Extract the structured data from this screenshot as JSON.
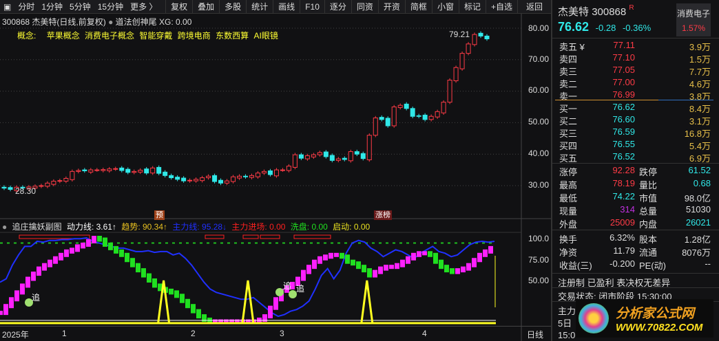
{
  "toolbar": {
    "left": [
      "分时",
      "1分钟",
      "5分钟",
      "15分钟",
      "更多 〉"
    ],
    "right": [
      "复权",
      "叠加",
      "多股",
      "统计",
      "画线",
      "F10",
      "逐分",
      "同资",
      "开资",
      "简框",
      "小窗",
      "标记",
      "+自选",
      "返回"
    ]
  },
  "header": {
    "title": "300868 杰美特(日线,前复权)",
    "formula": "道法创神尾",
    "xg": "XG: 0.00",
    "concept_label": "概念:",
    "concepts": [
      "苹果概念",
      "消费电子概念",
      "智能穿戴",
      "跨境电商",
      "东数西算",
      "AI眼镜"
    ]
  },
  "main_chart": {
    "high_label": "79.21",
    "low_label": "28.30",
    "marker_yu": "预",
    "marker_zb": "涨榜",
    "axis": [
      "80.00",
      "70.00",
      "60.00",
      "50.00",
      "40.00",
      "30.00"
    ],
    "closes": [
      29.2,
      28.8,
      29.5,
      29.3,
      29.6,
      29.8,
      30,
      30.8,
      31.4,
      31.6,
      32.3,
      34.5,
      34.8,
      34.7,
      35,
      35,
      35.1,
      35.3,
      35.4,
      34.8,
      34.2,
      34.5,
      34.9,
      34,
      35.6,
      33.9,
      33.2,
      32.5,
      32,
      31.5,
      31.7,
      32,
      32.5,
      33,
      31.3,
      30.8,
      31.5,
      32.8,
      33,
      32.8,
      33.2,
      34,
      34.5,
      33.5,
      35,
      35,
      36.2,
      39.8,
      38.7,
      39.5,
      39.8,
      40.5,
      39.2,
      38,
      38.5,
      38.3,
      40.8,
      40,
      38.6,
      46,
      51.5,
      51,
      49,
      55,
      55.5,
      54.5,
      52,
      52,
      51,
      52,
      53.5,
      56.5,
      63.5,
      67.5,
      72,
      75,
      78,
      77.5,
      76.6
    ]
  },
  "indicator": {
    "name": "追庄擒妖副图",
    "items": [
      {
        "text": "动力线: 3.61↑",
        "color": "#ffffff"
      },
      {
        "text": "趋势: 90.34↑",
        "color": "#e8c020"
      },
      {
        "text": "主力线: 95.28↓",
        "color": "#2030ff"
      },
      {
        "text": "主力进场: 0.00",
        "color": "#ff2020"
      },
      {
        "text": "洗盘: 0.00",
        "color": "#20e020"
      },
      {
        "text": "启动: 0.00",
        "color": "#e8e020"
      }
    ],
    "axis": [
      "100.0",
      "75.00",
      "50.00"
    ],
    "chase_label": "追",
    "blue": [
      48,
      52,
      68,
      80,
      90,
      90,
      96,
      95,
      97,
      97,
      98,
      98,
      99,
      99,
      100,
      96,
      94,
      92,
      90,
      88,
      88,
      86,
      84,
      84,
      85,
      83,
      84,
      84,
      80,
      82,
      76,
      68,
      58,
      48,
      40,
      36,
      34,
      32,
      30,
      28,
      28,
      30,
      24,
      18,
      12,
      8,
      10,
      14,
      16,
      20,
      26,
      40,
      56,
      64,
      52,
      62,
      82,
      94,
      97,
      95,
      88,
      84,
      78,
      82,
      86,
      84,
      80,
      76,
      82,
      86,
      90,
      84,
      82,
      78,
      80,
      86,
      92,
      95,
      96,
      95,
      96
    ],
    "trend": [
      12,
      20,
      28,
      36,
      44,
      52,
      58,
      64,
      68,
      72,
      76,
      80,
      84,
      86,
      90,
      92,
      96,
      100,
      98,
      92,
      88,
      84,
      80,
      74,
      68,
      62,
      56,
      50,
      44,
      40,
      38,
      36,
      32,
      26,
      20,
      14,
      8,
      4,
      2,
      2,
      2,
      2,
      2,
      2,
      2,
      2,
      2,
      4,
      8,
      18,
      28,
      38,
      42,
      46,
      52,
      60,
      66,
      72,
      76,
      78,
      80,
      80,
      78,
      72,
      70,
      66,
      62,
      56,
      60,
      64,
      66,
      66,
      68,
      72,
      76,
      80,
      82,
      82,
      80,
      72,
      66,
      62,
      60,
      62,
      64,
      68,
      74,
      80,
      84,
      88
    ],
    "spikes": [
      {
        "at": 0.33,
        "v": 50
      },
      {
        "at": 0.5,
        "v": 50
      },
      {
        "at": 0.74,
        "v": 50
      }
    ]
  },
  "x_axis": [
    "2025年",
    "1",
    "2",
    "3",
    "4",
    "日线"
  ],
  "quote": {
    "name": "杰美特",
    "code": "300868",
    "flag": "R",
    "price": "76.62",
    "change": "-0.28",
    "pct": "-0.36%",
    "sector": "消费电子",
    "sector_pct": "1.57%",
    "asks": [
      {
        "label": "卖五 ¥",
        "price": "77.11",
        "vol": "3.9万"
      },
      {
        "label": "卖四",
        "price": "77.10",
        "vol": "1.5万"
      },
      {
        "label": "卖三",
        "price": "77.05",
        "vol": "7.7万"
      },
      {
        "label": "卖二",
        "price": "77.00",
        "vol": "4.6万"
      },
      {
        "label": "卖一",
        "price": "76.99",
        "vol": "3.8万"
      }
    ],
    "bids": [
      {
        "label": "买一",
        "price": "76.62",
        "vol": "8.4万"
      },
      {
        "label": "买二",
        "price": "76.60",
        "vol": "3.1万"
      },
      {
        "label": "买三",
        "price": "76.59",
        "vol": "16.8万"
      },
      {
        "label": "买四",
        "price": "76.55",
        "vol": "5.4万"
      },
      {
        "label": "买五",
        "price": "76.52",
        "vol": "6.9万"
      }
    ],
    "stats": [
      [
        "涨停",
        "92.28",
        "跌停",
        "61.52"
      ],
      [
        "最高",
        "78.19",
        "量比",
        "0.68"
      ],
      [
        "最低",
        "74.22",
        "市值",
        "98.0亿"
      ],
      [
        "现量",
        "314",
        "总量",
        "51030"
      ],
      [
        "外盘",
        "25009",
        "内盘",
        "26021"
      ]
    ],
    "stats2": [
      [
        "换手",
        "6.32%",
        "股本",
        "1.28亿"
      ],
      [
        "净资",
        "11.79",
        "流通",
        "8076万"
      ],
      [
        "收益(三)",
        "-0.200",
        "PE(动)",
        "--"
      ]
    ],
    "tags": "注册制 已盈利 表决权无差异",
    "status": "交易状态: 闭市阶段 15:30:00",
    "more": [
      "主力",
      "5日",
      "15:0"
    ]
  },
  "watermark": {
    "cn": "分析家公式网",
    "url": "WWW.70822.COM"
  }
}
